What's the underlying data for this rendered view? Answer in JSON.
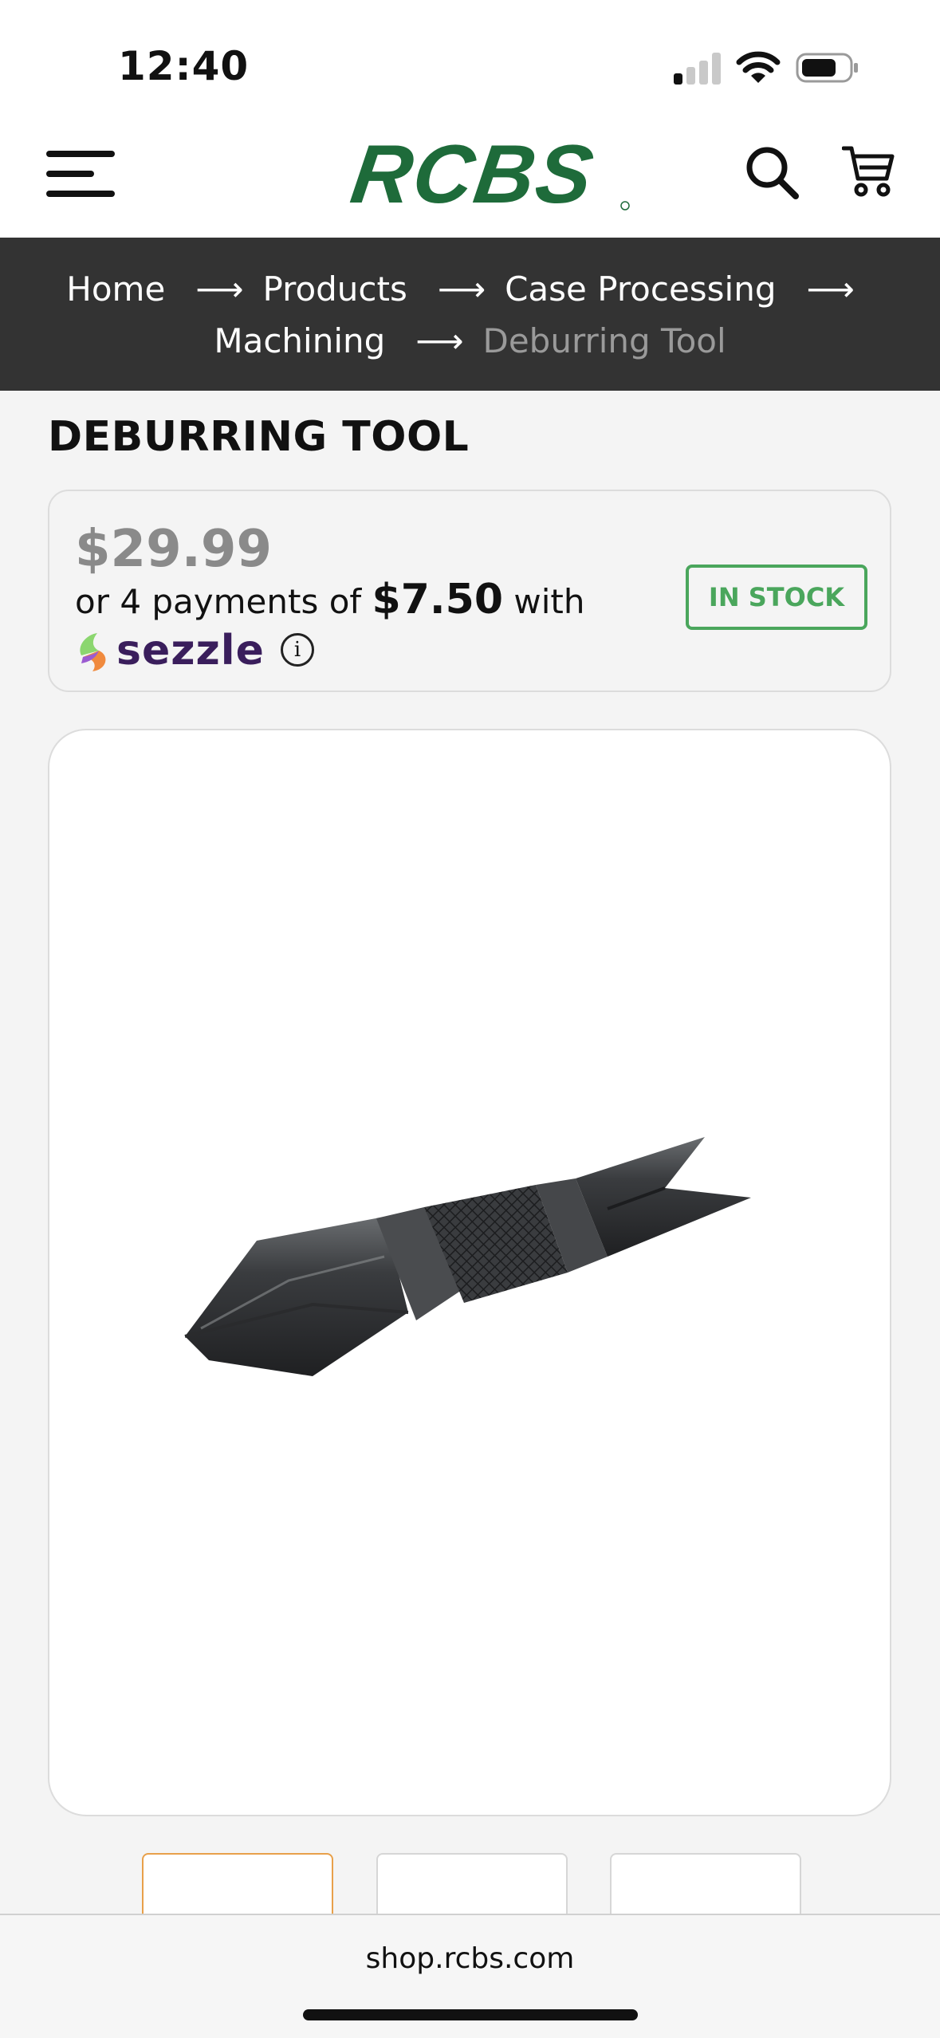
{
  "status_bar": {
    "time": "12:40",
    "signal_bars_active": 1,
    "signal_bars_total": 4
  },
  "header": {
    "logo_text": "RCBS",
    "logo_color": "#1e6b3a"
  },
  "breadcrumb": {
    "separator": "⟶",
    "items": [
      "Home",
      "Products",
      "Case Processing",
      "Machining"
    ],
    "current": "Deburring Tool"
  },
  "product": {
    "title": "DEBURRING TOOL",
    "price": "$29.99",
    "installment_prefix": "or 4 payments of ",
    "installment_amount": "$7.50",
    "installment_suffix": " with",
    "payment_provider": "sezzle",
    "info_glyph": "i",
    "stock_status": "IN STOCK",
    "stock_color": "#4aa65c"
  },
  "gallery": {
    "thumbnail_count": 3,
    "active_index": 0
  },
  "browser": {
    "url": "shop.rcbs.com"
  }
}
